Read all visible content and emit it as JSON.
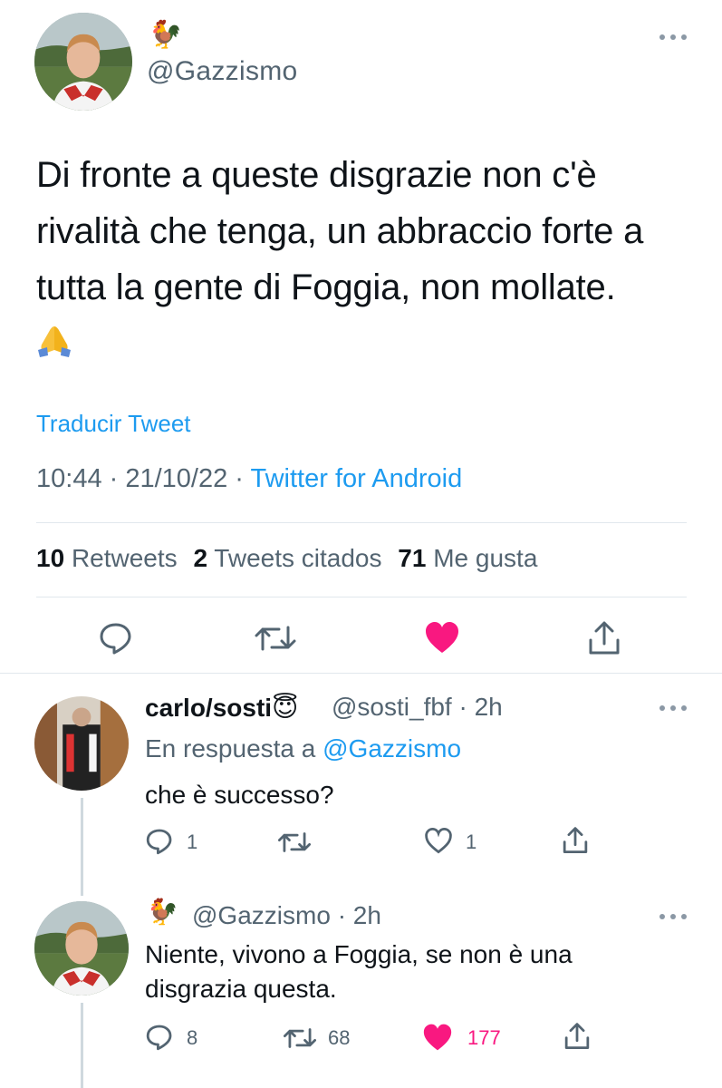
{
  "main_tweet": {
    "author_emoji": "🐓",
    "handle": "@Gazzismo",
    "text": "Di fronte a queste disgrazie non c'è rivalità che tenga, un abbraccio forte a tutta la gente di Foggia, non mollate.",
    "translate_label": "Traducir Tweet",
    "time": "10:44",
    "date": "21/10/22",
    "separator": " · ",
    "source": "Twitter for Android",
    "stats": {
      "retweets_count": "10",
      "retweets_label": "Retweets",
      "quotes_count": "2",
      "quotes_label": "Tweets citados",
      "likes_count": "71",
      "likes_label": "Me gusta"
    },
    "actions": [
      "reply-icon",
      "retweet-icon",
      "like-icon-filled",
      "share-icon"
    ]
  },
  "replies": [
    {
      "name": "carlo/sosti",
      "name_emoji": "😇",
      "handle": "@sosti_fbf",
      "time": "· 2h",
      "reply_to_label": "En respuesta a",
      "reply_to_handle": "@Gazzismo",
      "text": "che è successo?",
      "reply_count": "1",
      "retweet_count": "",
      "like_count": "1",
      "liked": false
    },
    {
      "name_emoji": "🐓",
      "handle": "@Gazzismo",
      "time": "· 2h",
      "text": "Niente, vivono a Foggia, se non è una disgrazia questa.",
      "reply_count": "8",
      "retweet_count": "68",
      "like_count": "177",
      "liked": true
    }
  ],
  "colors": {
    "accent": "#1d9bf0",
    "like": "#f91880",
    "muted": "#536471",
    "text": "#0f1419",
    "divider": "#e1e8ed"
  }
}
